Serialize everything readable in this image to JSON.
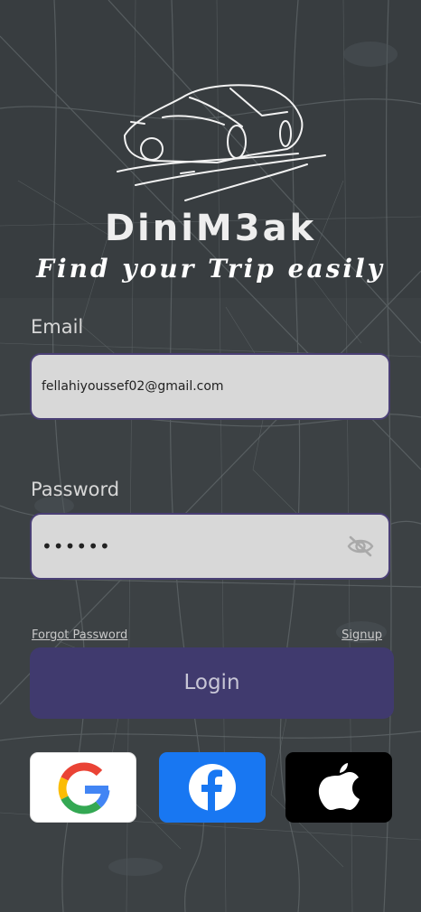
{
  "app": {
    "name": "DiniM3ak",
    "tagline": "Find your Trip easily"
  },
  "form": {
    "email_label": "Email",
    "email_value": "fellahiyoussef02@gmail.com",
    "password_label": "Password",
    "password_value": "••••••"
  },
  "links": {
    "forgot_password": "Forgot Password",
    "signup": "Signup"
  },
  "buttons": {
    "login": "Login"
  },
  "social": [
    {
      "name": "google",
      "icon": "google-logo-icon",
      "bg": "#ffffff"
    },
    {
      "name": "facebook",
      "icon": "facebook-logo-icon",
      "bg": "#1877f2"
    },
    {
      "name": "apple",
      "icon": "apple-logo-icon",
      "bg": "#000000"
    }
  ],
  "colors": {
    "background": "#3b4043",
    "field_bg": "#d8d8d8",
    "field_border": "#4a3f75",
    "accent": "#403a6e"
  }
}
